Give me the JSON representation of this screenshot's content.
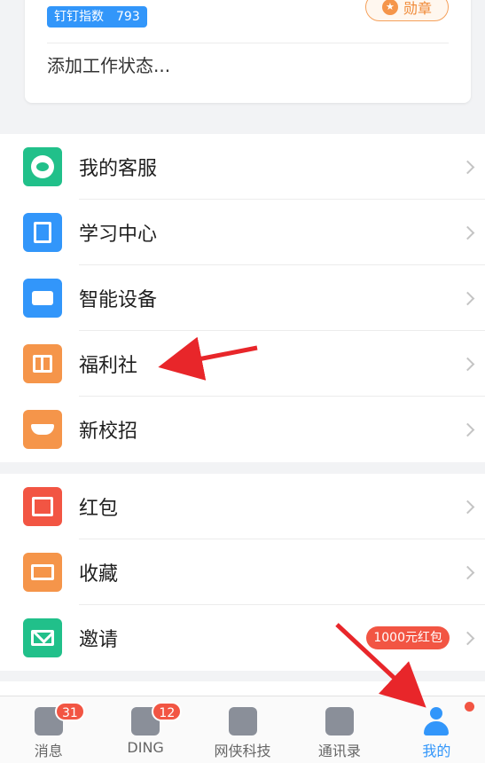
{
  "profile": {
    "index_label": "钉钉指数",
    "index_value": "793",
    "medal_label": "勋章",
    "status_placeholder": "添加工作状态..."
  },
  "group1": [
    {
      "label": "我的客服",
      "icon": "service-icon",
      "color": "#21c08a"
    },
    {
      "label": "学习中心",
      "icon": "book-icon",
      "color": "#3296fa"
    },
    {
      "label": "智能设备",
      "icon": "device-icon",
      "color": "#3296fa"
    },
    {
      "label": "福利社",
      "icon": "gift-icon",
      "color": "#f5954a"
    },
    {
      "label": "新校招",
      "icon": "graduation-cap-icon",
      "color": "#f5954a"
    }
  ],
  "group2": [
    {
      "label": "红包",
      "icon": "red-packet-icon",
      "color": "#f25543"
    },
    {
      "label": "收藏",
      "icon": "favorites-icon",
      "color": "#f5954a"
    },
    {
      "label": "邀请",
      "icon": "invite-mail-icon",
      "color": "#21c08a",
      "badge": "1000元红包"
    }
  ],
  "tabs": [
    {
      "label": "消息",
      "badge": "31",
      "icon": "message-icon",
      "active": false
    },
    {
      "label": "DING",
      "badge": "12",
      "icon": "pin-icon",
      "active": false
    },
    {
      "label": "网侠科技",
      "icon": "workbench-grid-icon",
      "active": false
    },
    {
      "label": "通讯录",
      "icon": "contacts-icon",
      "active": false
    },
    {
      "label": "我的",
      "icon": "person-icon",
      "active": true,
      "dot": true
    }
  ],
  "colors": {
    "accent": "#3296fa",
    "badge_red": "#f25543",
    "arrow_red": "#e8262a"
  }
}
